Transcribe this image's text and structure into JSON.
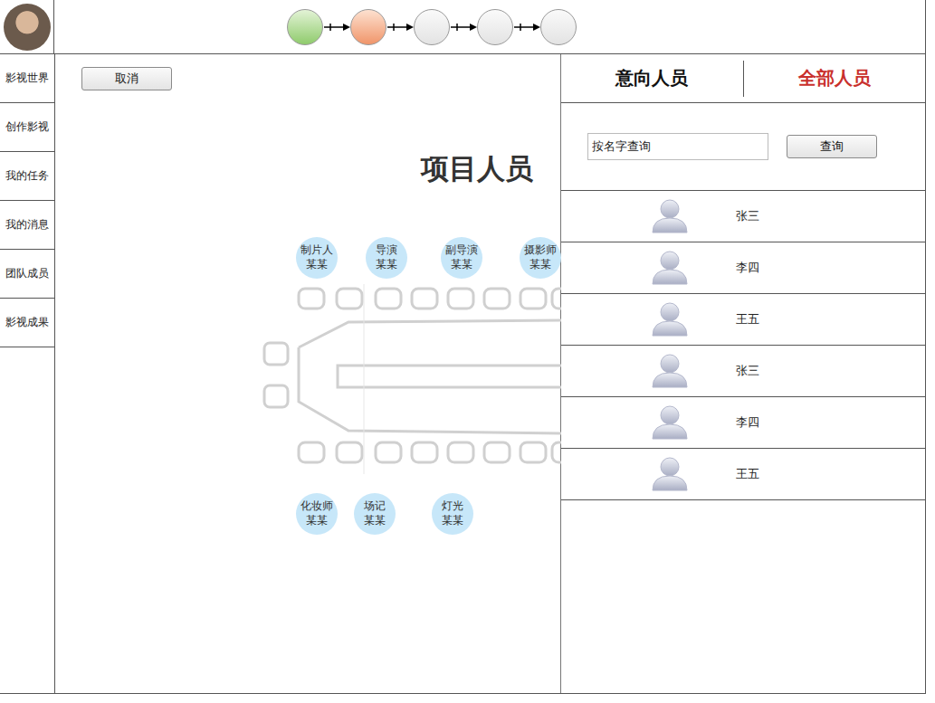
{
  "steps": [
    {
      "status": "done"
    },
    {
      "status": "current"
    },
    {
      "status": "todo"
    },
    {
      "status": "todo"
    },
    {
      "status": "todo"
    }
  ],
  "sidebar": {
    "items": [
      {
        "label": "影视世界"
      },
      {
        "label": "创作影视"
      },
      {
        "label": "我的任务"
      },
      {
        "label": "我的消息"
      },
      {
        "label": "团队成员"
      },
      {
        "label": "影视成果"
      }
    ]
  },
  "cancel_button": "取消",
  "title": "项目人员",
  "seats": {
    "top": [
      {
        "role": "制片人",
        "name": "某某"
      },
      {
        "role": "导演",
        "name": "某某"
      },
      {
        "role": "副导演",
        "name": "某某"
      },
      {
        "role": "摄影师",
        "name": "某某"
      }
    ],
    "bottom": [
      {
        "role": "化妆师",
        "name": "某某"
      },
      {
        "role": "场记",
        "name": "某某"
      },
      {
        "role": "灯光",
        "name": "某某"
      }
    ]
  },
  "tabs": [
    {
      "label": "意向人员",
      "selected": false
    },
    {
      "label": "全部人员",
      "selected": true
    }
  ],
  "search": {
    "value": "按名字查询",
    "button": "查询"
  },
  "people": [
    {
      "name": "张三"
    },
    {
      "name": "李四"
    },
    {
      "name": "王五"
    },
    {
      "name": "张三"
    },
    {
      "name": "李四"
    },
    {
      "name": "王五"
    }
  ]
}
